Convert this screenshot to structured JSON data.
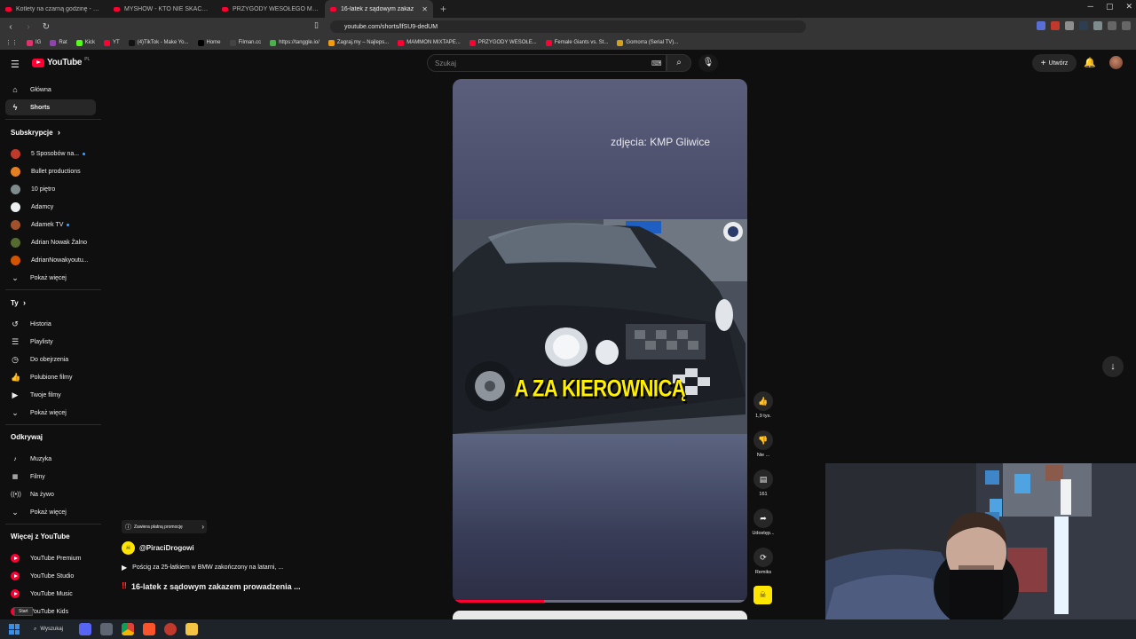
{
  "browser": {
    "tabs": [
      {
        "title": "Kotlety na czarną godzinę - mogą st",
        "active": false
      },
      {
        "title": "MYSHOW - KTO NIE SKACZE TEN Z",
        "active": false
      },
      {
        "title": "PRZYGODY WESOŁEGO MAZURA w",
        "active": false
      },
      {
        "title": "16-latek z sądowym zakaz",
        "active": true
      }
    ],
    "url": "youtube.com/shorts/lfSU9-dedUM",
    "bookmarks": [
      {
        "label": "IG",
        "color": "#e1306c"
      },
      {
        "label": "Rat",
        "color": "#8e44ad"
      },
      {
        "label": "Kick",
        "color": "#53fc18"
      },
      {
        "label": "YT",
        "color": "#ff0033"
      },
      {
        "label": "(4)TikTok - Make Yo...",
        "color": "#111111"
      },
      {
        "label": "Home",
        "color": "#000000"
      },
      {
        "label": "Filman.cc",
        "color": "#444444"
      },
      {
        "label": "https://tanggle.io/",
        "color": "#4caf50"
      },
      {
        "label": "Zagraj.my – Najleps...",
        "color": "#f39c12"
      },
      {
        "label": "MAMMON MIXTAPE...",
        "color": "#ff0033"
      },
      {
        "label": "PRZYGODY WESOŁE...",
        "color": "#ff0033"
      },
      {
        "label": "Female Giants vs. St...",
        "color": "#ff0033"
      },
      {
        "label": "Gomorra (Serial TV)...",
        "color": "#d4a017"
      }
    ]
  },
  "header": {
    "logo_text": "YouTube",
    "logo_region": "PL",
    "search_placeholder": "Szukaj",
    "create_label": "Utwórz"
  },
  "sidebar": {
    "main": [
      {
        "label": "Główna",
        "icon": "home-icon",
        "glyph": "⌂",
        "active": false
      },
      {
        "label": "Shorts",
        "icon": "shorts-icon",
        "glyph": "ϟ",
        "active": true
      }
    ],
    "subscriptions_heading": "Subskrypcje",
    "subscriptions": [
      {
        "label": "5 Sposobów na...",
        "color": "#c0392b",
        "live": true
      },
      {
        "label": "Bullet productions",
        "color": "#e67e22",
        "live": false
      },
      {
        "label": "10 piętro",
        "color": "#7f8c8d",
        "live": false
      },
      {
        "label": "Adamcy",
        "color": "#ecf0f1",
        "live": false
      },
      {
        "label": "Adamek TV",
        "color": "#a0522d",
        "live": true
      },
      {
        "label": "Adrian Nowak Żalno",
        "color": "#556b2f",
        "live": false
      },
      {
        "label": "AdrianNowakyoutu...",
        "color": "#d35400",
        "live": false
      }
    ],
    "show_more_1": "Pokaż więcej",
    "you_heading": "Ty",
    "you": [
      {
        "label": "Historia",
        "icon": "history-icon",
        "glyph": "↺"
      },
      {
        "label": "Playlisty",
        "icon": "playlists-icon",
        "glyph": "☰"
      },
      {
        "label": "Do obejrzenia",
        "icon": "watch-later-icon",
        "glyph": "◷"
      },
      {
        "label": "Polubione filmy",
        "icon": "liked-icon",
        "glyph": "👍"
      },
      {
        "label": "Twoje filmy",
        "icon": "your-videos-icon",
        "glyph": "▶"
      }
    ],
    "show_more_2": "Pokaż więcej",
    "explore_heading": "Odkrywaj",
    "explore": [
      {
        "label": "Muzyka",
        "icon": "music-icon",
        "glyph": "♪"
      },
      {
        "label": "Filmy",
        "icon": "movies-icon",
        "glyph": "▦"
      },
      {
        "label": "Na żywo",
        "icon": "live-icon",
        "glyph": "((•))"
      }
    ],
    "show_more_3": "Pokaż więcej",
    "more_heading": "Więcej z YouTube",
    "more": [
      {
        "label": "YouTube Premium"
      },
      {
        "label": "YouTube Studio"
      },
      {
        "label": "YouTube Music"
      },
      {
        "label": "YouTube Kids"
      }
    ]
  },
  "short": {
    "photo_credit": "zdjęcia: KMP Gliwice",
    "caption": "A ZA KIEROWNICĄ",
    "progress_percent": 31,
    "promo_label": "Zawiera płatną promocję",
    "channel": "@PiraciDrogowi",
    "playlist_label": "Pościg za 25-latkiem w BMW zakończony na latarni, ...",
    "title": "16-latek z sądowym zakazem prowadzenia ..."
  },
  "actions": {
    "likes": "1,9 tys.",
    "dislike": "Nie ...",
    "comments": "161",
    "share": "Udostęp...",
    "remix": "Remiks"
  },
  "taskbar": {
    "search_label": "Wyszukaj",
    "start_tooltip": "Start"
  }
}
